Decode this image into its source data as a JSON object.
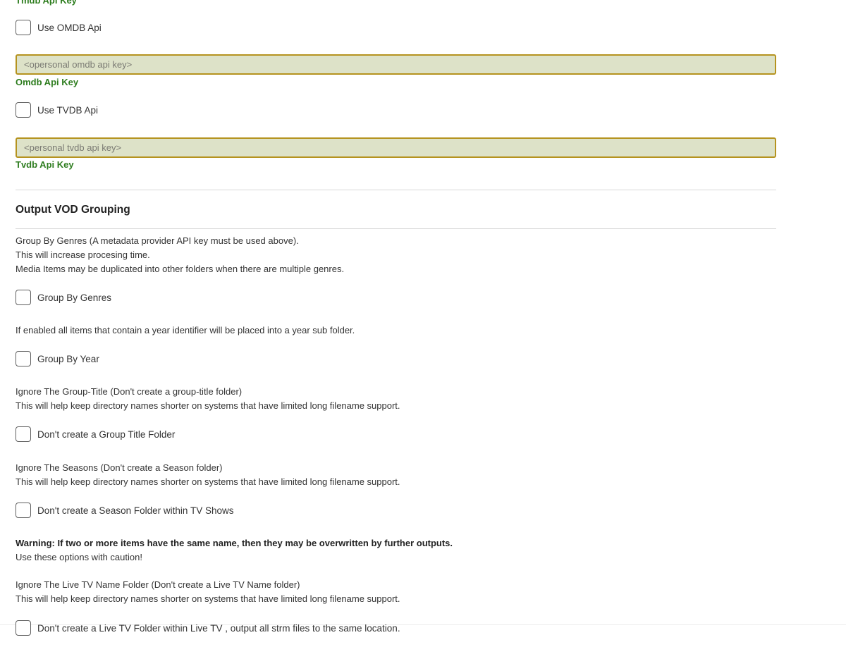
{
  "top_cut_label": "Tmdb Api Key",
  "omdb": {
    "checkbox_label": "Use OMDB Api",
    "input_placeholder": "<opersonal omdb api key>",
    "field_label": "Omdb Api Key",
    "checked": false
  },
  "tvdb": {
    "checkbox_label": "Use TVDB Api",
    "input_placeholder": "<personal tvdb api key>",
    "field_label": "Tvdb Api Key",
    "checked": false
  },
  "vod_section": {
    "title": "Output VOD Grouping",
    "genres_desc": [
      "Group By Genres (A metadata provider API key must be used above).",
      "This will increase procesing time.",
      "Media Items may be duplicated into other folders when there are multiple genres."
    ],
    "genres_checkbox": "Group By Genres",
    "year_desc": "If enabled all items that contain a year identifier will be placed into a year sub folder.",
    "year_checkbox": "Group By Year",
    "group_title_desc": [
      "Ignore The Group-Title (Don't create a group-title folder)",
      "This will help keep directory names shorter on systems that have limited long filename support."
    ],
    "group_title_checkbox": "Don't create a Group Title Folder",
    "seasons_desc": [
      "Ignore The Seasons (Don't create a Season folder)",
      "This will help keep directory names shorter on systems that have limited long filename support."
    ],
    "seasons_checkbox": "Don't create a Season Folder within TV Shows",
    "warning": "Warning: If two or more items have the same name, then they may be overwritten by further outputs.",
    "caution": "Use these options with caution!",
    "livetv_desc": [
      "Ignore The Live TV Name Folder (Don't create a Live TV Name folder)",
      "This will help keep directory names shorter on systems that have limited long filename support."
    ],
    "livetv_checkbox": "Don't create a Live TV Folder within Live TV , output all strm files to the same location."
  },
  "colors": {
    "accent_green": "#2e7d1f",
    "input_fill": "#dde2c8",
    "input_border": "#b5931f"
  }
}
